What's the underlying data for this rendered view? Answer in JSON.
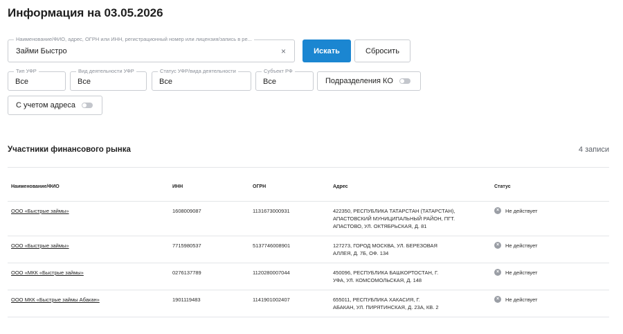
{
  "page_title": "Информация на 03.05.2026",
  "search": {
    "label": "Наименование/ФИО, адрес, ОГРН или ИНН, регистрационный номер или лицензия/запись в ре...",
    "value": "Займи Быстро",
    "clear_glyph": "×"
  },
  "buttons": {
    "search": "Искать",
    "reset": "Сбросить"
  },
  "filters": [
    {
      "label": "Тип УФР",
      "value": "Все"
    },
    {
      "label": "Вид деятельности УФР",
      "value": "Все"
    },
    {
      "label": "Статус УФР/вида деятельности",
      "value": "Все"
    },
    {
      "label": "Субъект РФ",
      "value": "Все"
    }
  ],
  "toggles": {
    "subdivisions": {
      "label": "Подразделения КО",
      "on": false
    },
    "with_address": {
      "label": "С учетом адреса",
      "on": false
    }
  },
  "section": {
    "title": "Участники финансового рынка",
    "count": "4 записи"
  },
  "table": {
    "headers": [
      "Наименование/ФИО",
      "ИНН",
      "ОГРН",
      "Адрес",
      "Статус"
    ],
    "rows": [
      {
        "name": "ООО «Быстрые займы»",
        "inn": "1608009087",
        "ogrn": "1131673000931",
        "address_lines": [
          "422350, Республика Татарстан (Татарстан),",
          "Апастовский муниципальный район, пгт.",
          "Апастово, ул. Октябрьская, д. 81"
        ],
        "status": "Не действует"
      },
      {
        "name": "ООО «Быстрые займы»",
        "inn": "7715980537",
        "ogrn": "5137746008901",
        "address_lines": [
          "127273, город Москва, ул. Березовая",
          "аллея, д. 7Б, оф. 134"
        ],
        "status": "Не действует"
      },
      {
        "name": "ООО «МКК «Быстрые займы»",
        "inn": "0276137789",
        "ogrn": "1120280007044",
        "address_lines": [
          "450096, Республика Башкортостан, г.",
          "Уфа, ул. Комсомольская, д. 148"
        ],
        "status": "Не действует"
      },
      {
        "name": "ООО МКК «Быстрые займы Абакан»",
        "inn": "1901119483",
        "ogrn": "1141901002407",
        "address_lines": [
          "655011, Республика Хакасия, г.",
          "Абакан, ул. Пирятинская, д. 23А, кв. 2"
        ],
        "status": "Не действует"
      }
    ]
  },
  "icons": {
    "status_inactive": "close-circle-icon",
    "clear": "close-icon"
  },
  "colors": {
    "accent": "#1b86d1",
    "status_inactive": "#9a9ea5"
  }
}
